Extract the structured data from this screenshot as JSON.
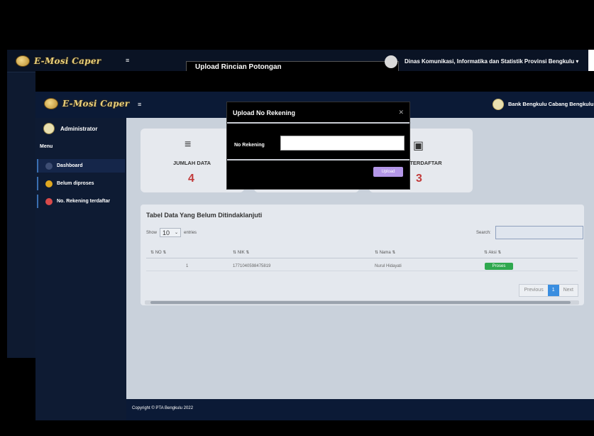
{
  "background_window": {
    "logo_text": "E-Mosi Caper",
    "modal_title": "Upload Rincian Potongan",
    "user_name": "Dinas Komunikasi, Informatika dan Statistik Provinsi Bengkulu",
    "user_caret": "▾",
    "hamburger": "≡"
  },
  "header": {
    "logo_text": "E-Mosi Caper",
    "hamburger": "≡",
    "user_name": "Bank Bengkulu Cabang Bengkulu",
    "user_caret": "▾"
  },
  "sidebar": {
    "user": "Administrator",
    "menu_label": "Menu",
    "items": [
      {
        "label": "Dashboard",
        "dot_color": "#3e4e74"
      },
      {
        "label": "Belum diproses",
        "dot_color": "#e0a820"
      },
      {
        "label": "No. Rekening terdaftar",
        "dot_color": "#d84a4a"
      }
    ]
  },
  "cards": [
    {
      "icon": "≡",
      "label": "JUMLAH DATA",
      "value": "4"
    },
    {
      "icon": "▣",
      "label": "NG TERDAFTAR",
      "value": "3"
    }
  ],
  "table": {
    "title": "Tabel Data Yang Belum Ditindaklanjuti",
    "show_label": "Show",
    "show_value": "10",
    "entries_label": "entries",
    "search_label": "Search:",
    "headers": [
      "NO",
      "NIK",
      "Nama",
      "Aksi"
    ],
    "rows": [
      {
        "no": "1",
        "nik": "1771040598475819",
        "nama": "Nurul Hidayati",
        "aksi": "Proses"
      }
    ],
    "pagination": {
      "previous": "Previous",
      "current": "1",
      "next": "Next"
    }
  },
  "footer": {
    "text": "Copyright © PTA Bengkulu 2022"
  },
  "modal": {
    "title": "Upload No Rekening",
    "close": "✕",
    "field_label": "No Rekening",
    "field_value": "",
    "upload_label": "Upload"
  },
  "colors": {
    "accent_blue": "#3a8ee0",
    "success_green": "#2fa84f",
    "upload_purple": "#b497e8",
    "card_value_red": "#c23b3b"
  }
}
